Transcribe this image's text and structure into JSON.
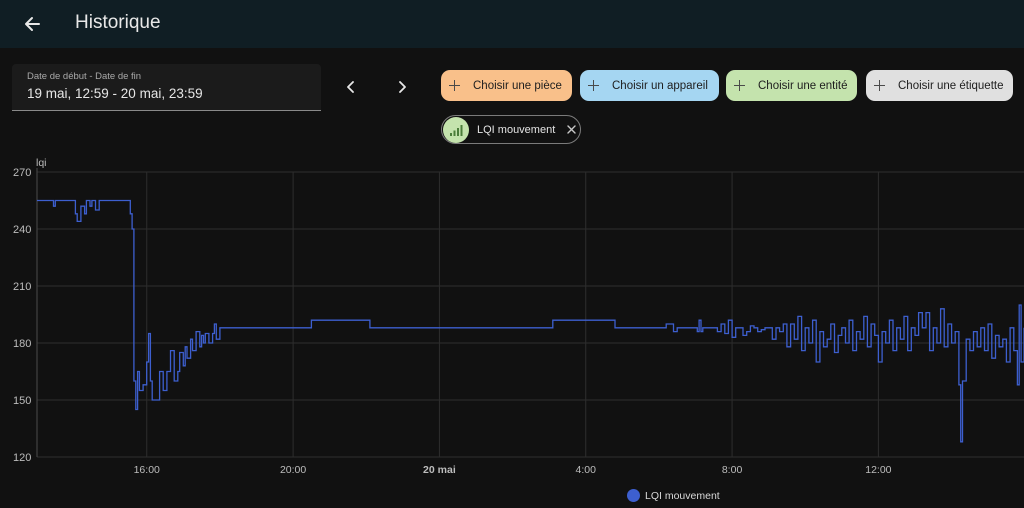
{
  "header": {
    "title": "Historique",
    "back_icon": "arrow-left-icon"
  },
  "date_range": {
    "label": "Date de début - Date de fin",
    "value": "19 mai, 12:59 - 20 mai, 23:59"
  },
  "nav": {
    "prev_icon": "chevron-left-icon",
    "next_icon": "chevron-right-icon"
  },
  "pickers": [
    {
      "label": "Choisir une pièce",
      "color": "#f9c08a"
    },
    {
      "label": "Choisir un appareil",
      "color": "#a5d6f2"
    },
    {
      "label": "Choisir une entité",
      "color": "#c4e3ad"
    },
    {
      "label": "Choisir une étiquette",
      "color": "#e0e0e0"
    }
  ],
  "selected_filter": {
    "label": "LQI mouvement",
    "icon": "signal-bars-icon",
    "close_icon": "close-icon"
  },
  "chart_data": {
    "type": "line",
    "ylabel": "lqi",
    "ylim": [
      120,
      270
    ],
    "yticks": [
      "270",
      "240",
      "210",
      "180",
      "150",
      "120"
    ],
    "xlim_hours": [
      13.0,
      39.98
    ],
    "xticks": [
      {
        "label": "16:00",
        "hour": 16,
        "bold": false
      },
      {
        "label": "20:00",
        "hour": 20,
        "bold": false
      },
      {
        "label": "20 mai",
        "hour": 24,
        "bold": true
      },
      {
        "label": "4:00",
        "hour": 28,
        "bold": false
      },
      {
        "label": "8:00",
        "hour": 32,
        "bold": false
      },
      {
        "label": "12:00",
        "hour": 36,
        "bold": false
      }
    ],
    "grid": true,
    "legend": "bottom-center",
    "series": [
      {
        "name": "LQI mouvement",
        "color": "#3d5fcf",
        "points": [
          [
            13.0,
            255
          ],
          [
            13.4,
            255
          ],
          [
            13.45,
            252
          ],
          [
            13.5,
            255
          ],
          [
            14.0,
            255
          ],
          [
            14.05,
            248
          ],
          [
            14.1,
            244
          ],
          [
            14.2,
            252
          ],
          [
            14.3,
            248
          ],
          [
            14.35,
            255
          ],
          [
            14.45,
            252
          ],
          [
            14.5,
            255
          ],
          [
            14.6,
            250
          ],
          [
            14.7,
            255
          ],
          [
            15.0,
            255
          ],
          [
            15.5,
            255
          ],
          [
            15.55,
            248
          ],
          [
            15.6,
            240
          ],
          [
            15.65,
            160
          ],
          [
            15.7,
            145
          ],
          [
            15.75,
            165
          ],
          [
            15.8,
            155
          ],
          [
            15.9,
            158
          ],
          [
            16.0,
            170
          ],
          [
            16.05,
            185
          ],
          [
            16.1,
            160
          ],
          [
            16.15,
            150
          ],
          [
            16.25,
            150
          ],
          [
            16.35,
            165
          ],
          [
            16.45,
            155
          ],
          [
            16.55,
            165
          ],
          [
            16.65,
            176
          ],
          [
            16.75,
            160
          ],
          [
            16.85,
            165
          ],
          [
            16.9,
            175
          ],
          [
            17.0,
            168
          ],
          [
            17.05,
            178
          ],
          [
            17.1,
            172
          ],
          [
            17.2,
            182
          ],
          [
            17.25,
            176
          ],
          [
            17.35,
            186
          ],
          [
            17.45,
            178
          ],
          [
            17.5,
            184
          ],
          [
            17.55,
            180
          ],
          [
            17.6,
            185
          ],
          [
            17.7,
            180
          ],
          [
            17.8,
            185
          ],
          [
            17.85,
            190
          ],
          [
            17.9,
            182
          ],
          [
            18.0,
            188
          ],
          [
            20.5,
            188
          ],
          [
            20.5,
            192
          ],
          [
            22.1,
            192
          ],
          [
            22.1,
            188
          ],
          [
            27.1,
            188
          ],
          [
            27.1,
            192
          ],
          [
            28.8,
            192
          ],
          [
            28.8,
            188
          ],
          [
            30.2,
            188
          ],
          [
            30.2,
            190
          ],
          [
            30.4,
            190
          ],
          [
            30.4,
            186
          ],
          [
            30.5,
            188
          ],
          [
            31.0,
            188
          ],
          [
            31.05,
            186
          ],
          [
            31.1,
            192
          ],
          [
            31.15,
            186
          ],
          [
            31.2,
            188
          ],
          [
            31.5,
            188
          ],
          [
            31.6,
            186
          ],
          [
            31.7,
            190
          ],
          [
            31.8,
            185
          ],
          [
            31.9,
            192
          ],
          [
            32.0,
            183
          ],
          [
            32.1,
            188
          ],
          [
            32.2,
            188
          ],
          [
            32.3,
            184
          ],
          [
            32.4,
            186
          ],
          [
            32.5,
            189
          ],
          [
            32.6,
            188
          ],
          [
            32.7,
            186
          ],
          [
            32.8,
            187
          ],
          [
            32.9,
            188
          ],
          [
            33.0,
            188
          ],
          [
            33.1,
            182
          ],
          [
            33.2,
            188
          ],
          [
            33.3,
            186
          ],
          [
            33.4,
            190
          ],
          [
            33.5,
            178
          ],
          [
            33.6,
            190
          ],
          [
            33.7,
            182
          ],
          [
            33.8,
            194
          ],
          [
            33.9,
            176
          ],
          [
            34.0,
            188
          ],
          [
            34.1,
            180
          ],
          [
            34.2,
            192
          ],
          [
            34.3,
            170
          ],
          [
            34.4,
            186
          ],
          [
            34.5,
            178
          ],
          [
            34.6,
            182
          ],
          [
            34.7,
            190
          ],
          [
            34.8,
            175
          ],
          [
            34.9,
            184
          ],
          [
            35.0,
            188
          ],
          [
            35.1,
            180
          ],
          [
            35.2,
            192
          ],
          [
            35.3,
            176
          ],
          [
            35.4,
            186
          ],
          [
            35.5,
            182
          ],
          [
            35.6,
            194
          ],
          [
            35.7,
            178
          ],
          [
            35.8,
            190
          ],
          [
            35.9,
            184
          ],
          [
            36.0,
            170
          ],
          [
            36.1,
            186
          ],
          [
            36.2,
            180
          ],
          [
            36.3,
            192
          ],
          [
            36.4,
            176
          ],
          [
            36.5,
            188
          ],
          [
            36.6,
            182
          ],
          [
            36.7,
            194
          ],
          [
            36.8,
            176
          ],
          [
            36.9,
            188
          ],
          [
            37.0,
            184
          ],
          [
            37.05,
            184
          ],
          [
            37.1,
            196
          ],
          [
            37.2,
            188
          ],
          [
            37.3,
            196
          ],
          [
            37.4,
            176
          ],
          [
            37.5,
            188
          ],
          [
            37.6,
            180
          ],
          [
            37.7,
            198
          ],
          [
            37.8,
            178
          ],
          [
            37.9,
            190
          ],
          [
            38.0,
            180
          ],
          [
            38.1,
            186
          ],
          [
            38.2,
            158
          ],
          [
            38.25,
            128
          ],
          [
            38.3,
            160
          ],
          [
            38.4,
            182
          ],
          [
            38.5,
            176
          ],
          [
            38.6,
            186
          ],
          [
            38.7,
            178
          ],
          [
            38.8,
            188
          ],
          [
            38.9,
            176
          ],
          [
            39.0,
            190
          ],
          [
            39.1,
            172
          ],
          [
            39.2,
            184
          ],
          [
            39.3,
            178
          ],
          [
            39.4,
            182
          ],
          [
            39.5,
            170
          ],
          [
            39.6,
            188
          ],
          [
            39.7,
            176
          ],
          [
            39.8,
            158
          ],
          [
            39.85,
            200
          ],
          [
            39.9,
            170
          ],
          [
            39.98,
            188
          ]
        ]
      }
    ]
  }
}
